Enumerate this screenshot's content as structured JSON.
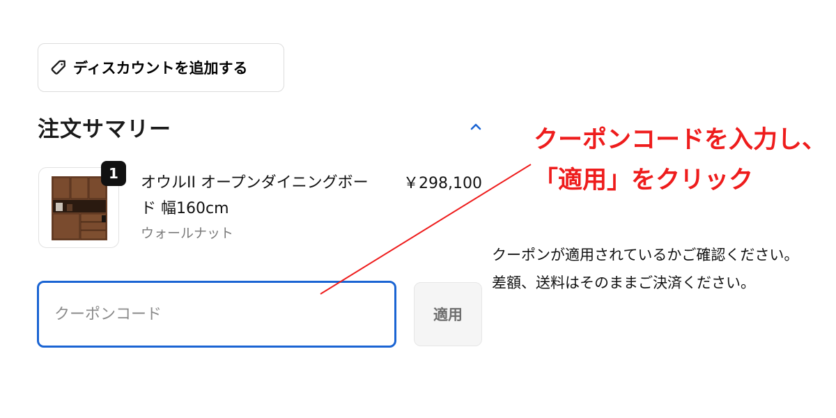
{
  "discount": {
    "button_label": "ディスカウントを追加する",
    "icon": "tag-icon"
  },
  "summary": {
    "title": "注文サマリー",
    "toggle_icon": "chevron-up-icon"
  },
  "item": {
    "quantity": "1",
    "name": "オウルII オープンダイニングボード 幅160cm",
    "variant": "ウォールナット",
    "price": "￥298,100"
  },
  "coupon": {
    "placeholder": "クーポンコード",
    "value": "",
    "apply_label": "適用"
  },
  "annotation": {
    "line1": "クーポンコードを入力し、",
    "line2": "「適用」をクリック",
    "note_line1": "クーポンが適用されているかご確認ください。",
    "note_line2": "差額、送料はそのままご決済ください。",
    "color": "#ee1c1c"
  },
  "colors": {
    "focus_border": "#1a64d3",
    "badge_bg": "#111111",
    "muted_text": "#7a7a7a"
  }
}
